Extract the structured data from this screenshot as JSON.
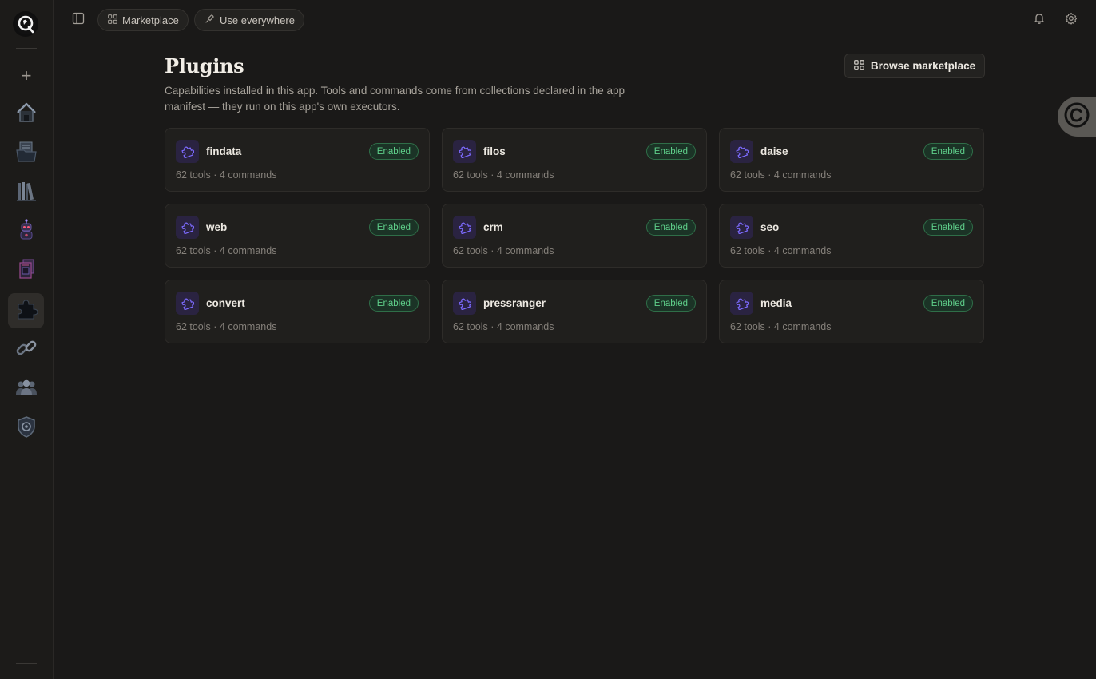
{
  "topbar": {
    "marketplace_label": "Marketplace",
    "use_everywhere_label": "Use everywhere"
  },
  "page": {
    "title": "Plugins",
    "description": "Capabilities installed in this app. Tools and commands come from collections declared in the app manifest — they run on this app's own executors.",
    "browse_label": "Browse marketplace"
  },
  "plugins": [
    {
      "name": "findata",
      "status": "Enabled",
      "meta": "62 tools · 4 commands"
    },
    {
      "name": "filos",
      "status": "Enabled",
      "meta": "62 tools · 4 commands"
    },
    {
      "name": "daise",
      "status": "Enabled",
      "meta": "62 tools · 4 commands"
    },
    {
      "name": "web",
      "status": "Enabled",
      "meta": "62 tools · 4 commands"
    },
    {
      "name": "crm",
      "status": "Enabled",
      "meta": "62 tools · 4 commands"
    },
    {
      "name": "seo",
      "status": "Enabled",
      "meta": "62 tools · 4 commands"
    },
    {
      "name": "convert",
      "status": "Enabled",
      "meta": "62 tools · 4 commands"
    },
    {
      "name": "pressranger",
      "status": "Enabled",
      "meta": "62 tools · 4 commands"
    },
    {
      "name": "media",
      "status": "Enabled",
      "meta": "62 tools · 4 commands"
    }
  ],
  "rail": {
    "items": [
      {
        "icon": "home-icon"
      },
      {
        "icon": "folder-documents-icon"
      },
      {
        "icon": "library-icon"
      },
      {
        "icon": "robot-agent-icon"
      },
      {
        "icon": "document-stack-icon"
      },
      {
        "icon": "puzzle-plugins-icon",
        "active": true
      },
      {
        "icon": "link-chain-icon"
      },
      {
        "icon": "people-group-icon"
      },
      {
        "icon": "shield-security-icon"
      }
    ]
  },
  "colors": {
    "background": "#1a1918",
    "card": "#201f1d",
    "accent_purple": "#7d6bff",
    "enabled_green": "#5fcf8a"
  }
}
